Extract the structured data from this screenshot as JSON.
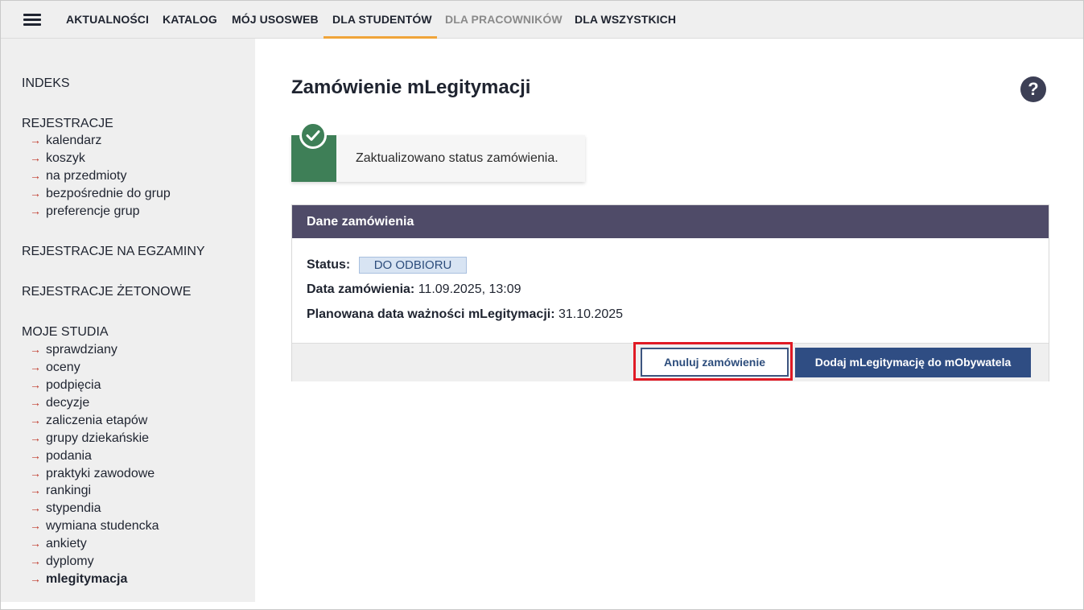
{
  "nav": {
    "items": [
      {
        "label": "AKTUALNOŚCI"
      },
      {
        "label": "KATALOG"
      },
      {
        "label": "MÓJ USOSWEB"
      },
      {
        "label": "DLA STUDENTÓW"
      },
      {
        "label": "DLA PRACOWNIKÓW"
      },
      {
        "label": "DLA WSZYSTKICH"
      }
    ],
    "active": "DLA STUDENTÓW",
    "accent_color": "#f0a43a"
  },
  "sidebar": {
    "indeks": "INDEKS",
    "rejestracje": {
      "title": "REJESTRACJE",
      "links": [
        "kalendarz",
        "koszyk",
        "na przedmioty",
        "bezpośrednie do grup",
        "preferencje grup"
      ]
    },
    "egzaminy": "REJESTRACJE NA EGZAMINY",
    "zetonowe": "REJESTRACJE ŻETONOWE",
    "moje_studia": {
      "title": "MOJE STUDIA",
      "links": [
        "sprawdziany",
        "oceny",
        "podpięcia",
        "decyzje",
        "zaliczenia etapów",
        "grupy dziekańskie",
        "podania",
        "praktyki zawodowe",
        "rankingi",
        "stypendia",
        "wymiana studencka",
        "ankiety",
        "dyplomy",
        "mlegitymacja"
      ],
      "active": "mlegitymacja"
    }
  },
  "main": {
    "title": "Zamówienie mLegitymacji",
    "help_icon": "question-circle-icon",
    "alert": {
      "icon": "check-circle-icon",
      "text": "Zaktualizowano status zamówienia.",
      "color": "#3e7f57"
    },
    "panel": {
      "header": "Dane zamówienia",
      "status_label": "Status:",
      "status_value": "DO ODBIORU",
      "order_date_label": "Data zamówienia:",
      "order_date_value": "11.09.2025, 13:09",
      "expiry_label": "Planowana data ważności mLegitymacji:",
      "expiry_value": "31.10.2025",
      "cancel_button": "Anuluj zamówienie",
      "add_button": "Dodaj mLegitymację do mObywatela",
      "header_color": "#4f4b68",
      "primary_color": "#2f4d83",
      "highlight_color": "#e01a24"
    }
  }
}
